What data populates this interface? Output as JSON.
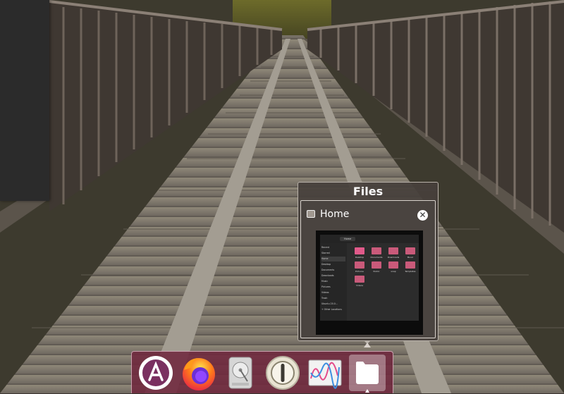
{
  "popup": {
    "title": "Files",
    "window": {
      "title": "Home",
      "close_symbol": "✕"
    },
    "thumbnail": {
      "sidebar_items": [
        "Recent",
        "Starred",
        "Home",
        "Desktop",
        "Documents",
        "Downloads",
        "Music",
        "Pictures",
        "Videos",
        "Trash",
        "Ubuntu 20.0...",
        "+ Other Locations"
      ],
      "folders": [
        "Desktop",
        "Documents",
        "Downloads",
        "Music",
        "Pictures",
        "Public",
        "snap",
        "Templates",
        "Videos"
      ],
      "location_label": "Home"
    }
  },
  "dock": {
    "items": [
      {
        "name": "app-center-icon",
        "label": "Ubuntu Software"
      },
      {
        "name": "firefox-icon",
        "label": "Firefox"
      },
      {
        "name": "disk-icon",
        "label": "Disks"
      },
      {
        "name": "password-manager-icon",
        "label": "Passwords"
      },
      {
        "name": "system-monitor-icon",
        "label": "System Monitor"
      },
      {
        "name": "files-icon",
        "label": "Files"
      }
    ]
  },
  "colors": {
    "dock_bg": "#70283e",
    "popup_bg": "#46403c",
    "accent_red": "#e95420"
  }
}
